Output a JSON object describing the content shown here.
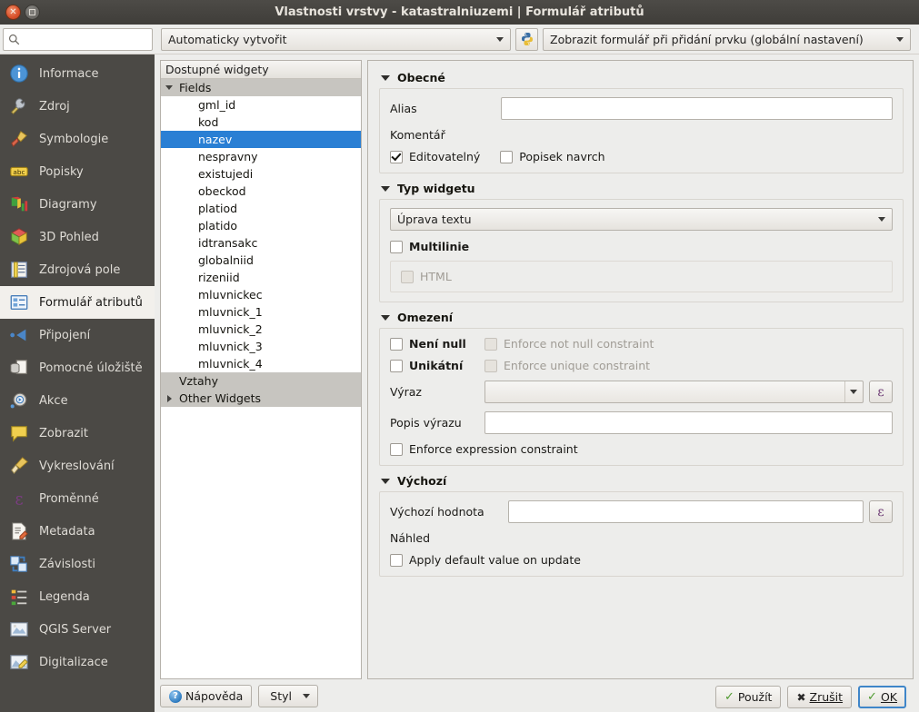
{
  "window": {
    "title": "Vlastnosti vrstvy - katastralniuzemi | Formulář atributů",
    "close_icon": "close-icon",
    "maximize_icon": "maximize-icon"
  },
  "search": {
    "value": "",
    "placeholder": "",
    "icon": "search-icon"
  },
  "toolbar": {
    "editor_layout": "Automaticky vytvořit",
    "python_button_icon": "python-icon",
    "form_suppress": "Zobrazit formulář při přidání prvku (globální nastavení)"
  },
  "sidebar": {
    "items": [
      {
        "label": "Informace",
        "icon": "info-icon"
      },
      {
        "label": "Zdroj",
        "icon": "source-icon"
      },
      {
        "label": "Symbologie",
        "icon": "symbology-icon"
      },
      {
        "label": "Popisky",
        "icon": "labels-icon"
      },
      {
        "label": "Diagramy",
        "icon": "diagrams-icon"
      },
      {
        "label": "3D Pohled",
        "icon": "3d-view-icon"
      },
      {
        "label": "Zdrojová pole",
        "icon": "source-fields-icon"
      },
      {
        "label": "Formulář atributů",
        "icon": "attributes-form-icon",
        "active": true
      },
      {
        "label": "Připojení",
        "icon": "joins-icon"
      },
      {
        "label": "Pomocné úložiště",
        "icon": "auxiliary-storage-icon"
      },
      {
        "label": "Akce",
        "icon": "actions-icon"
      },
      {
        "label": "Zobrazit",
        "icon": "display-icon"
      },
      {
        "label": "Vykreslování",
        "icon": "rendering-icon"
      },
      {
        "label": "Proměnné",
        "icon": "variables-icon"
      },
      {
        "label": "Metadata",
        "icon": "metadata-icon"
      },
      {
        "label": "Závislosti",
        "icon": "dependencies-icon"
      },
      {
        "label": "Legenda",
        "icon": "legend-icon"
      },
      {
        "label": "QGIS Server",
        "icon": "qgis-server-icon"
      },
      {
        "label": "Digitalizace",
        "icon": "digitizing-icon"
      }
    ]
  },
  "tree": {
    "header": "Dostupné widgety",
    "groups": [
      {
        "label": "Fields",
        "expanded": true
      },
      {
        "label": "Vztahy",
        "expanded": false,
        "no_twisty": true
      },
      {
        "label": "Other Widgets",
        "expanded": false
      }
    ],
    "fields": [
      "gml_id",
      "kod",
      "nazev",
      "nespravny",
      "existujedi",
      "obeckod",
      "platiod",
      "platido",
      "idtransakc",
      "globalniid",
      "rizeniid",
      "mluvnickec",
      "mluvnick_1",
      "mluvnick_2",
      "mluvnick_3",
      "mluvnick_4"
    ],
    "selected_field": "nazev"
  },
  "tree_footer": {
    "help_label": "Nápověda",
    "style_label": "Styl"
  },
  "general": {
    "section_title": "Obecné",
    "alias_label": "Alias",
    "alias_value": "",
    "comment_label": "Komentář",
    "editable_label": "Editovatelný",
    "editable_checked": true,
    "label_on_top_label": "Popisek navrch",
    "label_on_top_checked": false
  },
  "widget_type": {
    "section_title": "Typ widgetu",
    "selected": "Úprava textu",
    "multiline_label": "Multilinie",
    "multiline_checked": false,
    "html_label": "HTML",
    "html_checked": false,
    "html_disabled": true
  },
  "constraints": {
    "section_title": "Omezení",
    "not_null_label": "Není null",
    "not_null_checked": false,
    "enforce_not_null_label": "Enforce not null constraint",
    "enforce_not_null_checked": false,
    "unique_label": "Unikátní",
    "unique_checked": false,
    "enforce_unique_label": "Enforce unique constraint",
    "enforce_unique_checked": false,
    "expression_label": "Výraz",
    "expression_value": "",
    "expression_desc_label": "Popis výrazu",
    "expression_desc_value": "",
    "enforce_expression_label": "Enforce expression constraint",
    "enforce_expression_checked": false,
    "expression_button_icon": "epsilon-expression-icon"
  },
  "defaults": {
    "section_title": "Výchozí",
    "default_value_label": "Výchozí hodnota",
    "default_value": "",
    "preview_label": "Náhled",
    "apply_on_update_label": "Apply default value on update",
    "apply_on_update_checked": false,
    "expression_button_icon": "epsilon-expression-icon"
  },
  "dialog_buttons": {
    "apply": "Použít",
    "cancel": "Zrušit",
    "ok": "OK"
  }
}
